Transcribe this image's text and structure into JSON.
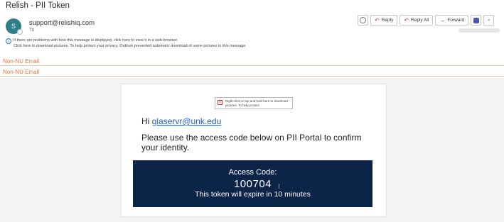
{
  "window": {
    "subject": "Relish - PII Token"
  },
  "sender": {
    "avatar_initial": "S",
    "email": "support@relishiq.com",
    "to_label": "To"
  },
  "toolbar": {
    "reply_label": "Reply",
    "reply_all_label": "Reply All",
    "forward_label": "Forward"
  },
  "info_bar": {
    "line1": "If there are problems with how this message is displayed, click here to view it in a web browser.",
    "line2": "Click here to download pictures. To help protect your privacy, Outlook prevented automatic download of some pictures in this message."
  },
  "banners": [
    "Non-NU Email",
    "Non-NU Email"
  ],
  "email_body": {
    "image_placeholder": "Right-click or tap and hold here to download pictures. To help protect",
    "greeting_prefix": "Hi",
    "recipient_email": "glaservr@unk.edu",
    "message": "Please use the access code below on PII Portal to confirm your identity.",
    "code_label": "Access Code:",
    "code_value": "100704",
    "expiry_text": "This token will expire in 10 minutes"
  },
  "colors": {
    "code_box_bg": "#0b2447",
    "banner_text": "#e8743b",
    "avatar_bg": "#2f7f88",
    "link": "#1f5fbf"
  },
  "icons": [
    "emoji-icon",
    "reply-icon",
    "reply-all-icon",
    "forward-icon",
    "teams-icon",
    "more-icon",
    "info-icon",
    "broken-image-icon",
    "text-cursor-icon"
  ]
}
